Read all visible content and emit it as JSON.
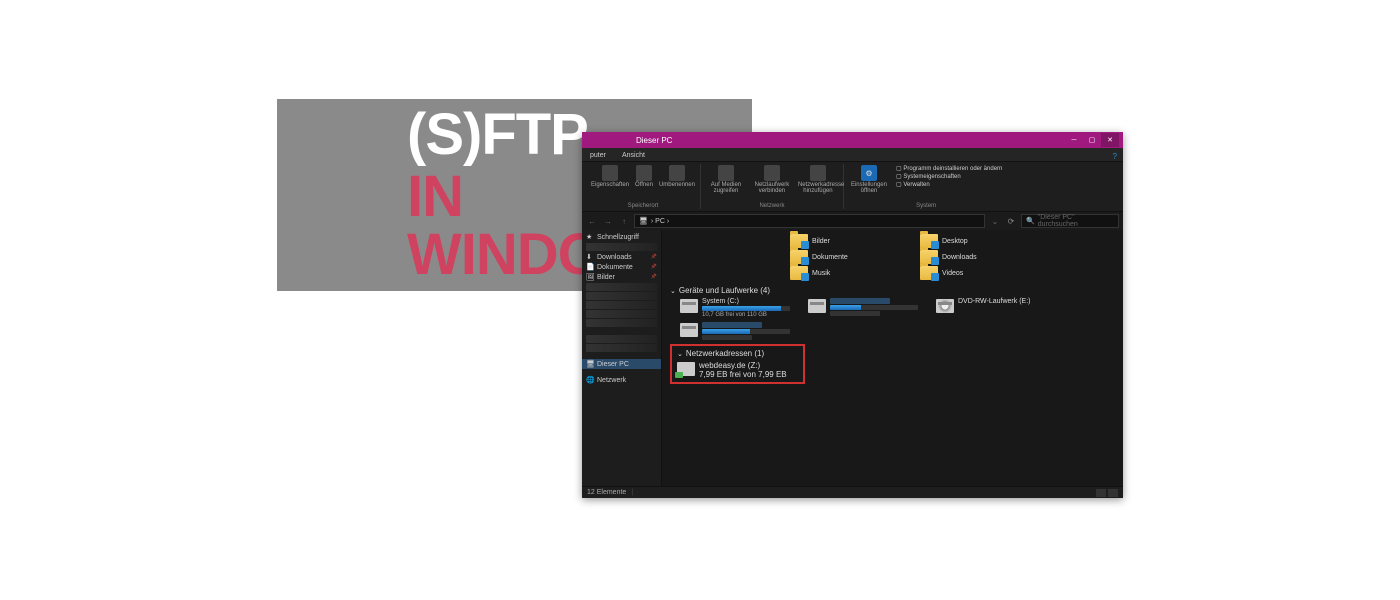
{
  "banner": {
    "line1": "(S)FTP",
    "line2": "IN WINDOWS"
  },
  "window": {
    "title": "Dieser PC",
    "tabs": {
      "computer": "puter",
      "ansicht": "Ansicht"
    },
    "ribbon": {
      "storage_group": "Speicherort",
      "eigenschaften": "Eigenschaften",
      "offnen": "Öffnen",
      "umbenennen": "Umbenennen",
      "network_group": "Netzwerk",
      "auf_medien": "Auf Medien zugreifen",
      "netzlaufwerk": "Netzlaufwerk verbinden",
      "netzwerkadresse": "Netzwerkadresse hinzufügen",
      "system_group": "System",
      "einstellungen": "Einstellungen öffnen",
      "programm": "Programm deinstallieren oder ändern",
      "systemeig": "Systemeigenschaften",
      "verwalten": "Verwalten"
    },
    "address": "› PC ›",
    "search_placeholder": "\"Dieser PC\" durchsuchen",
    "sidebar": {
      "schnellzugriff": "Schnellzugriff",
      "downloads": "Downloads",
      "dokumente": "Dokumente",
      "bilder": "Bilder",
      "dieser_pc": "Dieser PC",
      "netzwerk": "Netzwerk"
    },
    "folders": {
      "bilder": "Bilder",
      "desktop": "Desktop",
      "dokumente": "Dokumente",
      "downloads": "Downloads",
      "musik": "Musik",
      "videos": "Videos"
    },
    "drives_header": "Geräte und Laufwerke (4)",
    "drives": {
      "c": {
        "name": "System (C:)",
        "free": "10,7 GB frei von 110 GB",
        "pct": 90
      },
      "d": {
        "name": "",
        "free": "",
        "pct": 35
      },
      "e": {
        "name": "DVD-RW-Laufwerk (E:)",
        "free": "",
        "pct": 0
      }
    },
    "netaddr_header": "Netzwerkadressen (1)",
    "netdrive": {
      "name": "webdeasy.de (Z:)",
      "free": "7,99 EB frei von 7,99 EB",
      "pct": 2
    },
    "status": "12 Elemente"
  }
}
